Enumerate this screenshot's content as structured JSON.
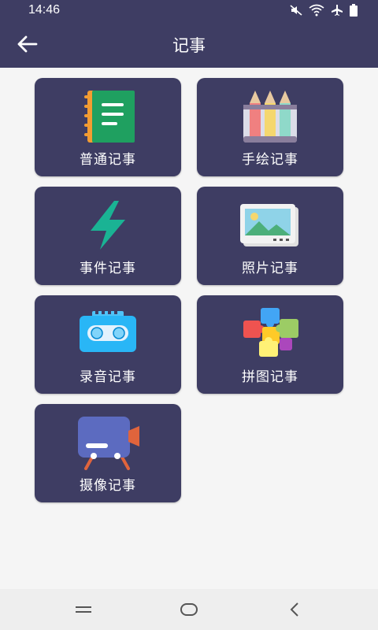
{
  "status_bar": {
    "time": "14:46",
    "icons": [
      "mute-icon",
      "wifi-icon",
      "airplane-icon",
      "battery-icon"
    ]
  },
  "app_bar": {
    "back_icon": "arrow-left-icon",
    "title": "记事"
  },
  "cards": [
    {
      "label": "普通记事",
      "icon": "notebook-icon"
    },
    {
      "label": "手绘记事",
      "icon": "pencils-icon"
    },
    {
      "label": "事件记事",
      "icon": "lightning-icon"
    },
    {
      "label": "照片记事",
      "icon": "photo-icon"
    },
    {
      "label": "录音记事",
      "icon": "cassette-icon"
    },
    {
      "label": "拼图记事",
      "icon": "puzzle-icon"
    },
    {
      "label": "摄像记事",
      "icon": "video-camera-icon"
    }
  ],
  "nav_bar": {
    "icons": [
      "menu-icon",
      "home-icon",
      "back-icon"
    ]
  },
  "colors": {
    "bar": "#3e3d63",
    "card": "#3e3d63",
    "background": "#f5f5f5",
    "nav": "#eeeeee"
  }
}
